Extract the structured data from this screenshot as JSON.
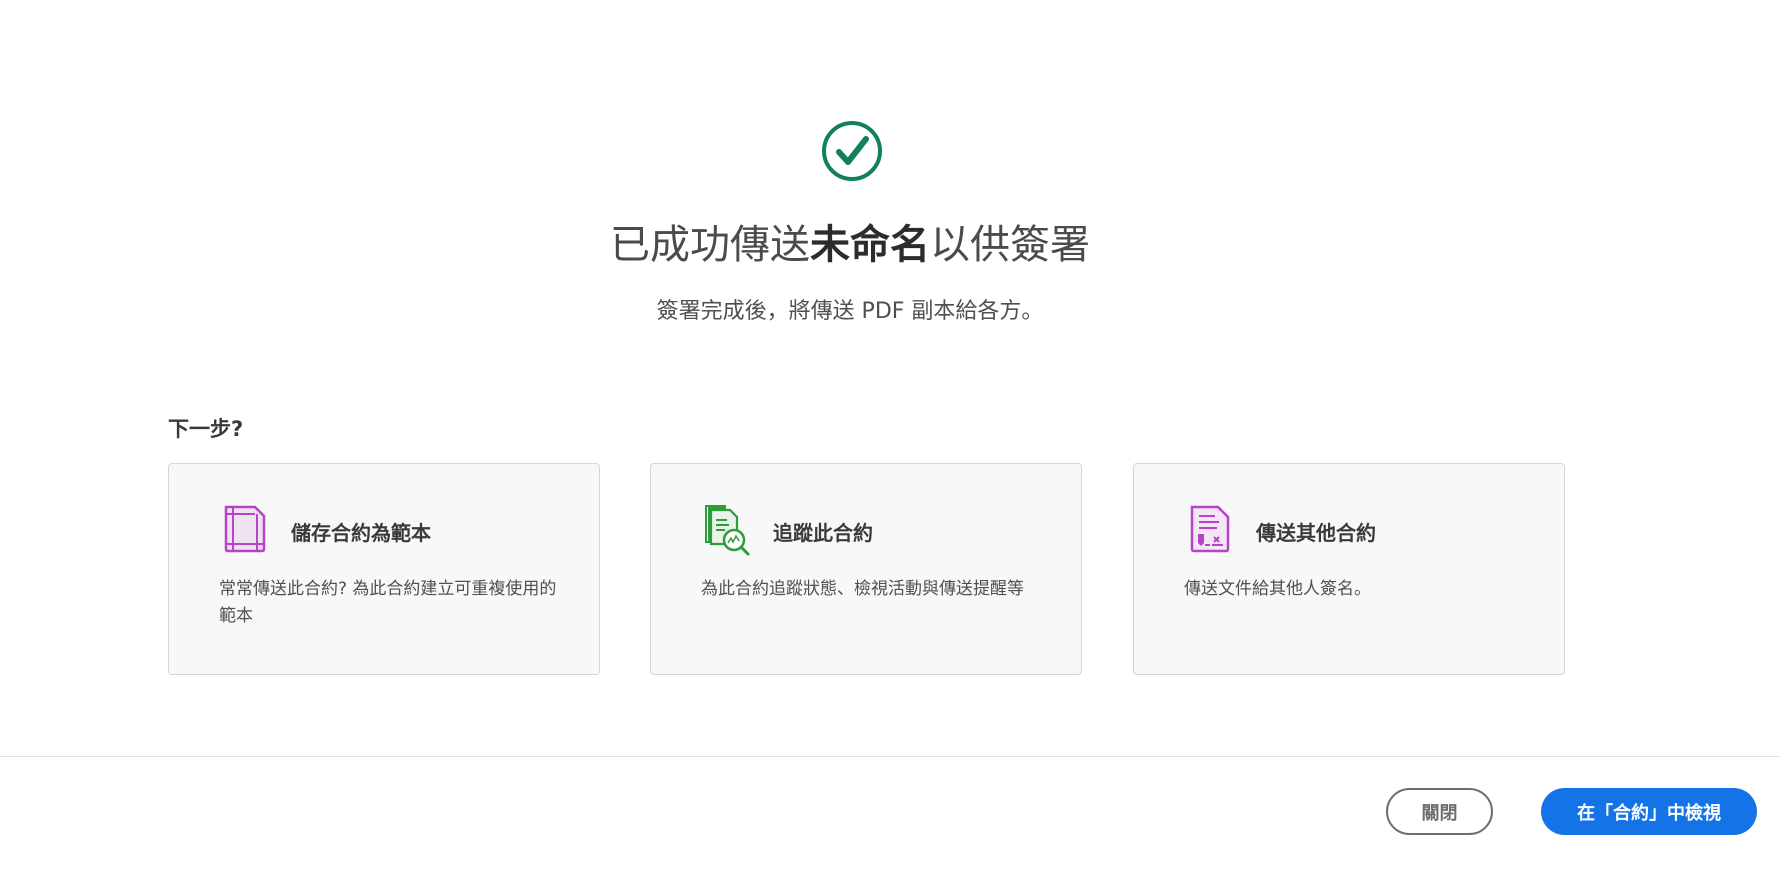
{
  "header": {
    "status_icon": "check-circle-icon",
    "title_prefix": "已成功傳送",
    "title_name": "未命名",
    "title_suffix": "以供簽署",
    "subtitle": "簽署完成後，將傳送 PDF 副本給各方。"
  },
  "next_steps": {
    "heading": "下一步?",
    "cards": [
      {
        "icon": "template-icon",
        "title": "儲存合約為範本",
        "desc": "常常傳送此合約? 為此合約建立可重複使用的範本"
      },
      {
        "icon": "track-document-icon",
        "title": "追蹤此合約",
        "desc": "為此合約追蹤狀態、檢視活動與傳送提醒等"
      },
      {
        "icon": "send-document-icon",
        "title": "傳送其他合約",
        "desc": "傳送文件給其他人簽名。"
      }
    ]
  },
  "footer": {
    "close_label": "關閉",
    "view_label": "在「合約」中檢視"
  },
  "colors": {
    "success": "#12805c",
    "primary": "#1473e6",
    "purple": "#b744c8",
    "green": "#2d9d3a"
  }
}
